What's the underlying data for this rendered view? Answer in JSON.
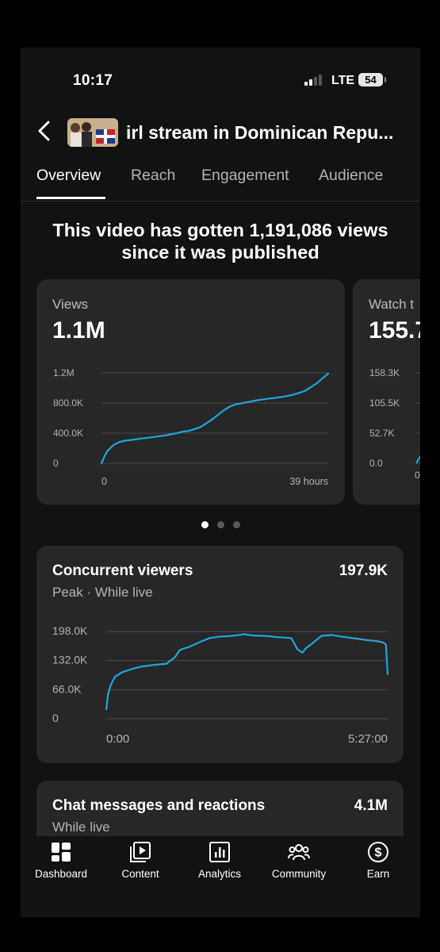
{
  "status_bar": {
    "time": "10:17",
    "network": "LTE",
    "battery": "54"
  },
  "header": {
    "title": "irl stream in Dominican Repu..."
  },
  "tabs": [
    {
      "label": "Overview",
      "active": true
    },
    {
      "label": "Reach",
      "active": false
    },
    {
      "label": "Engagement",
      "active": false
    },
    {
      "label": "Audience",
      "active": false
    }
  ],
  "headline": "This video has gotten 1,191,086 views since it was published",
  "cards": [
    {
      "label": "Views",
      "value": "1.1M"
    },
    {
      "label": "Watch t",
      "value": "155.7"
    }
  ],
  "carousel": {
    "pages": 3,
    "active_page": 1
  },
  "concurrent": {
    "title": "Concurrent viewers",
    "subtitle": "Peak · While live",
    "value": "197.9K"
  },
  "chat": {
    "title": "Chat messages and reactions",
    "subtitle": "While live",
    "value": "4.1M"
  },
  "nav": [
    {
      "label": "Dashboard",
      "icon": "dashboard-icon"
    },
    {
      "label": "Content",
      "icon": "content-icon"
    },
    {
      "label": "Analytics",
      "icon": "analytics-icon"
    },
    {
      "label": "Community",
      "icon": "community-icon"
    },
    {
      "label": "Earn",
      "icon": "earn-icon"
    }
  ],
  "colors": {
    "accent": "#1ea7d8",
    "background": "#121212",
    "card": "#272727"
  },
  "chart_data": [
    {
      "type": "line",
      "title": "Views",
      "y_ticks": [
        "1.2M",
        "800.0K",
        "400.0K",
        "0"
      ],
      "x_ticks": [
        "0",
        "39 hours"
      ],
      "ylim": [
        0,
        1200000
      ],
      "xlim": [
        0,
        39
      ],
      "x": [
        0,
        0.5,
        1,
        2,
        3,
        4,
        5,
        7,
        9,
        11,
        13,
        14,
        15,
        17,
        19,
        21,
        22,
        23,
        25,
        27,
        29,
        31,
        33,
        35,
        37,
        39
      ],
      "y": [
        0,
        90000,
        160000,
        240000,
        280000,
        300000,
        310000,
        330000,
        350000,
        370000,
        400000,
        420000,
        430000,
        480000,
        580000,
        700000,
        750000,
        780000,
        810000,
        840000,
        860000,
        880000,
        910000,
        960000,
        1060000,
        1191086
      ]
    },
    {
      "type": "line",
      "title": "Watch t",
      "y_ticks": [
        "158.3K",
        "105.5K",
        "52.7K",
        "0.0"
      ]
    },
    {
      "type": "line",
      "title": "Concurrent viewers",
      "y_ticks": [
        "198.0K",
        "132.0K",
        "66.0K",
        "0"
      ],
      "x_ticks": [
        "0:00",
        "5:27:00"
      ],
      "ylim": [
        0,
        198000
      ],
      "xlim": [
        0,
        327
      ],
      "x": [
        0,
        2,
        5,
        10,
        18,
        28,
        40,
        55,
        70,
        80,
        85,
        88,
        95,
        110,
        120,
        130,
        145,
        155,
        160,
        170,
        185,
        200,
        215,
        222,
        228,
        232,
        240,
        250,
        262,
        275,
        290,
        305,
        315,
        322,
        325,
        327
      ],
      "y": [
        20000,
        55000,
        75000,
        95000,
        105000,
        112000,
        118000,
        122000,
        125000,
        140000,
        155000,
        158000,
        162000,
        175000,
        183000,
        186000,
        188000,
        190000,
        192000,
        189000,
        188000,
        185000,
        183000,
        158000,
        150000,
        160000,
        172000,
        188000,
        190000,
        186000,
        182000,
        178000,
        176000,
        173000,
        168000,
        100000
      ]
    }
  ]
}
